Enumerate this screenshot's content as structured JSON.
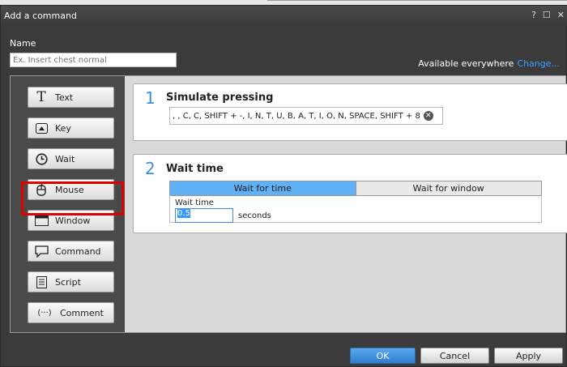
{
  "window": {
    "title": "Add a command",
    "help_label": "?",
    "maximize_label": "☐",
    "close_label": "✕"
  },
  "name": {
    "label": "Name",
    "placeholder": "Ex. Insert chest normal",
    "value": ""
  },
  "availability": {
    "text": "Available everywhere",
    "change_link": "Change..."
  },
  "commands": [
    {
      "label": "Text",
      "icon": "text-icon",
      "glyph": "T"
    },
    {
      "label": "Key",
      "icon": "key-icon",
      "glyph": "▲"
    },
    {
      "label": "Wait",
      "icon": "clock-icon",
      "glyph": "◷"
    },
    {
      "label": "Mouse",
      "icon": "mouse-icon",
      "glyph": "🖱"
    },
    {
      "label": "Window",
      "icon": "window-icon",
      "glyph": "▭"
    },
    {
      "label": "Command",
      "icon": "speech-bubble-icon",
      "glyph": "💬"
    },
    {
      "label": "Script",
      "icon": "script-icon",
      "glyph": "▤"
    },
    {
      "label": "Comment",
      "icon": "comment-icon",
      "glyph": "(···)"
    }
  ],
  "step1": {
    "number": "1",
    "title": "Simulate pressing",
    "keys": ", , C, C, SHIFT + -, I, N, T, U, B, A, T, I, O, N, SPACE, SHIFT + 8",
    "clear_glyph": "✕"
  },
  "step2": {
    "number": "2",
    "title": "Wait time",
    "tabs": [
      {
        "label": "Wait for time",
        "active": true
      },
      {
        "label": "Wait for window",
        "active": false
      }
    ],
    "field_label": "Wait time",
    "value": "0.5",
    "unit": "seconds"
  },
  "footer": {
    "ok": "OK",
    "cancel": "Cancel",
    "apply": "Apply"
  },
  "colors": {
    "accent": "#3a8ee6",
    "highlight": "#e00000",
    "dialog_bg": "#3b3b3b"
  }
}
